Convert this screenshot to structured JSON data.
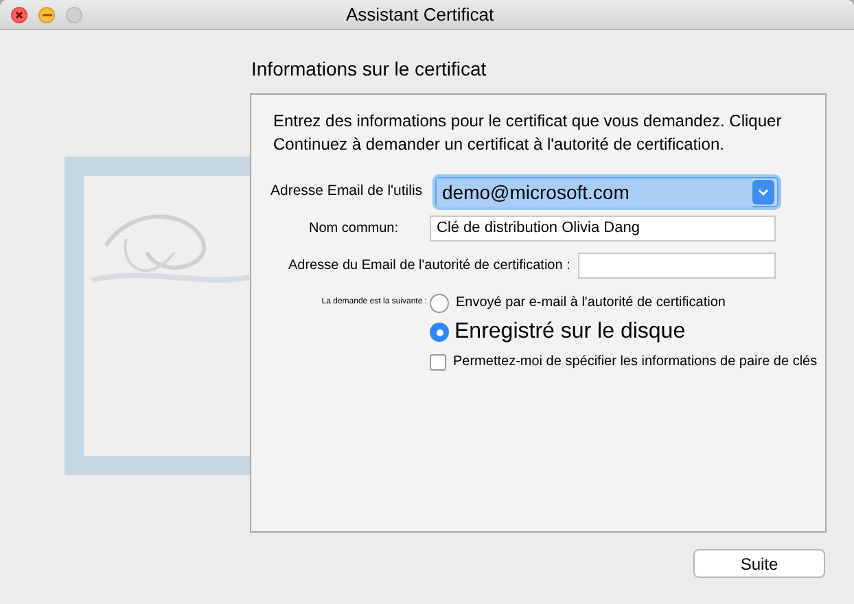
{
  "window": {
    "title": "Assistant Certificat"
  },
  "heading": "Informations sur le certificat",
  "intro": "Entrez des informations pour le certificat que vous demandez. Cliquer Continuez à demander un certificat à l'autorité de certification.",
  "fields": [
    {
      "kind": "dropdown",
      "label": "Adresse Email de l'utilis",
      "value": "demo@microsoft.com"
    },
    {
      "kind": "text",
      "label": "Nom commun:",
      "value": "Clé de distribution Olivia Dang"
    },
    {
      "kind": "text",
      "label": "Adresse du Email de l'autorité de certification :"
    }
  ],
  "request_label": "La demande est la suivante :",
  "options": [
    {
      "kind": "radio",
      "label": "Envoyé par e-mail à l'autorité de certification",
      "selected": false
    },
    {
      "kind": "radio",
      "label": "Enregistré sur le disque",
      "selected": true
    },
    {
      "kind": "checkbox",
      "label": "Permettez-moi de spécifier les informations de paire de clés",
      "checked": false
    }
  ],
  "buttons": [
    "Suite"
  ]
}
